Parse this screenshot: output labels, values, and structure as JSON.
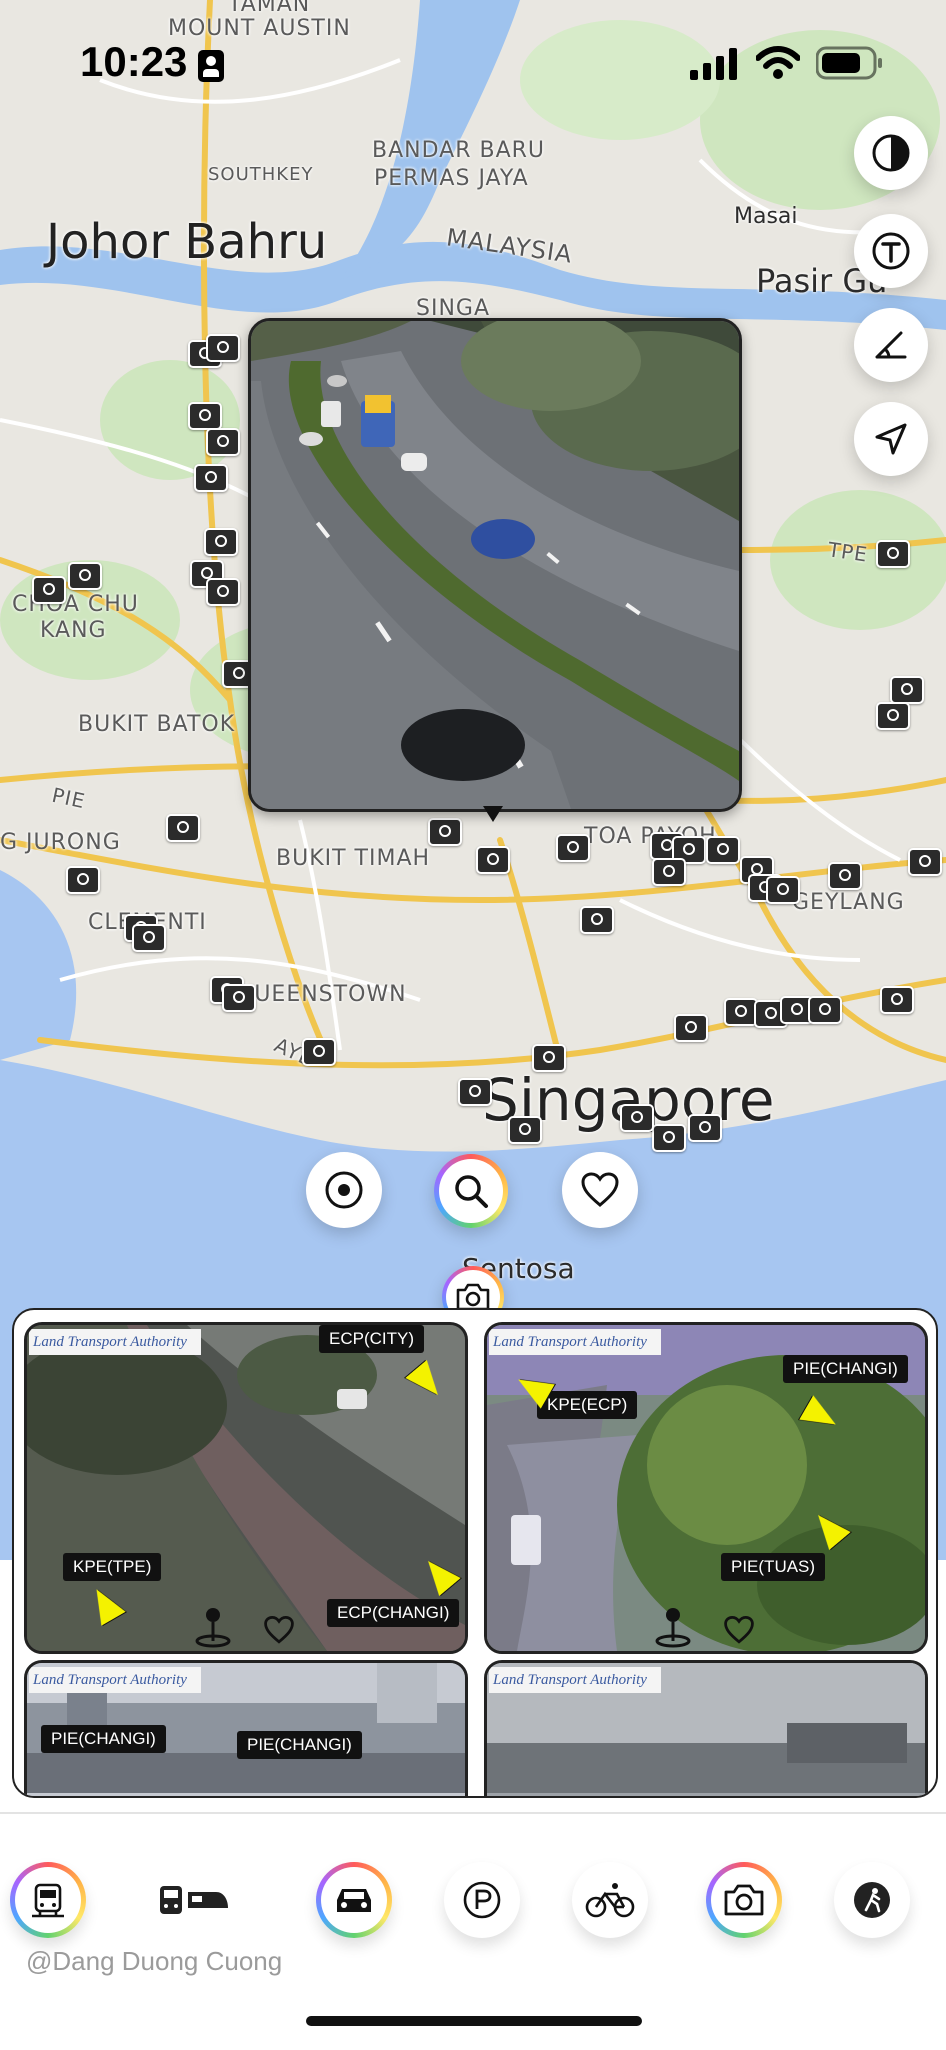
{
  "status_bar": {
    "time": "10:23"
  },
  "map": {
    "labels": {
      "taman": "TAMAN",
      "mount_austin": "MOUNT AUSTIN",
      "southkey": "SOUTHKEY",
      "bandar_baru": "BANDAR BARU",
      "permas_jaya": "PERMAS JAYA",
      "johor_bahru": "Johor Bahru",
      "malaysia": "MALAYSIA",
      "masai": "Masai",
      "pasir_gudang": "Pasir Gu",
      "tpe": "TPE",
      "choa_chu": "CHOA CHU",
      "kang": "KANG",
      "bukit_batok": "BUKIT BATOK",
      "pie": "PIE",
      "jurong": "G JURONG",
      "bukit_timah": "BUKIT TIMAH",
      "toa_payoh": "TOA PAYOH",
      "geylang": "GEYLANG",
      "clementi": "CLEMENTI",
      "queenstown": "QUEENSTOWN",
      "aye": "AYE",
      "singapore": "Singapore",
      "sentosa": "Sentosa",
      "sing": "SINGA"
    }
  },
  "camera_grid": {
    "tiles": [
      {
        "lta": "Land Transport Authority",
        "tags": [
          "ECP(CITY)",
          "KPE(TPE)",
          "ECP(CHANGI)"
        ]
      },
      {
        "lta": "Land Transport Authority",
        "tags": [
          "PIE(CHANGI)",
          "KPE(ECP)",
          "PIE(TUAS)"
        ]
      },
      {
        "lta": "Land Transport Authority",
        "tags": [
          "PIE(CHANGI)",
          "PIE(CHANGI)"
        ]
      },
      {
        "lta": "Land Transport Authority",
        "tags": []
      }
    ]
  },
  "credit": "@Dang Duong Cuong"
}
